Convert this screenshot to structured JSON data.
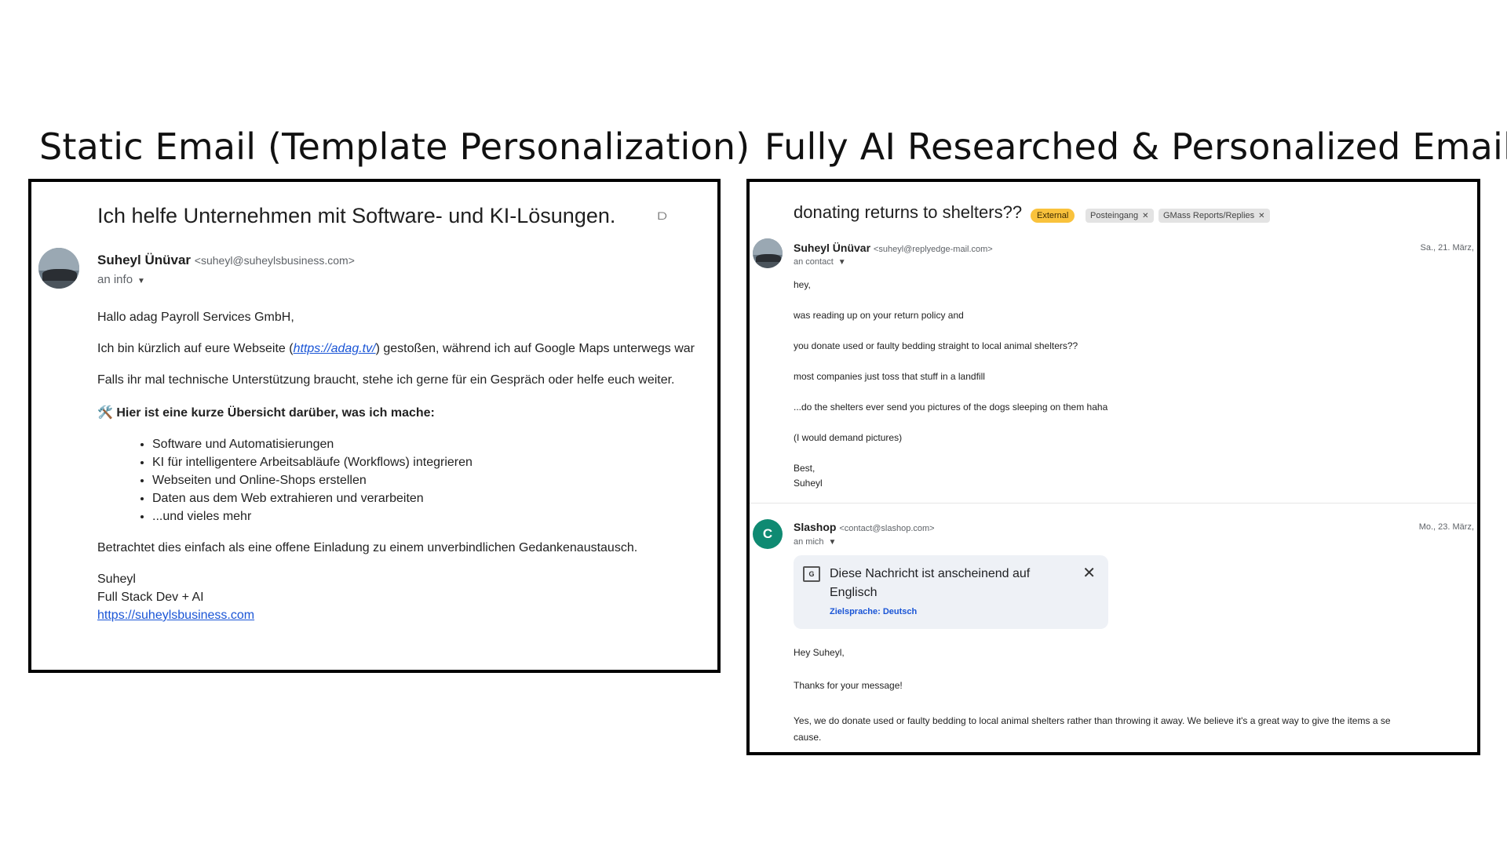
{
  "headings": {
    "left": "Static Email (Template Personalization)",
    "right": "Fully AI Researched & Personalized Email"
  },
  "left_email": {
    "subject": "Ich helfe Unternehmen mit Software- und KI-Lösungen.",
    "sender_name": "Suheyl Ünüvar",
    "sender_email": "<suheyl@suheylsbusiness.com>",
    "recipient": "an info",
    "greeting": "Hallo adag Payroll Services GmbH,",
    "intro_before_link": "Ich bin kürzlich auf eure Webseite (",
    "intro_link": "https://adag.tv/",
    "intro_after_link": ") gestoßen, während ich auf Google Maps unterwegs war",
    "offer": "Falls ihr mal technische Unterstützung braucht, stehe ich gerne für ein Gespräch oder helfe euch weiter.",
    "overview_icon": "🛠️",
    "overview_heading": "Hier ist eine kurze Übersicht darüber, was ich mache:",
    "services": [
      "Software und Automatisierungen",
      "KI für intelligentere Arbeitsabläufe (Workflows) integrieren",
      "Webseiten und Online-Shops erstellen",
      "Daten aus dem Web extrahieren und verarbeiten",
      "...und vieles mehr"
    ],
    "closing": "Betrachtet dies einfach als eine offene Einladung zu einem unverbindlichen Gedankenaustausch.",
    "signature_name": "Suheyl",
    "signature_title": "Full Stack Dev + AI",
    "signature_link": "https://suheylsbusiness.com"
  },
  "right_email": {
    "subject": "donating returns to shelters??",
    "labels": {
      "external": "External",
      "inbox": "Posteingang",
      "gmass": "GMass Reports/Replies"
    },
    "message1": {
      "sender_name": "Suheyl Ünüvar",
      "sender_email": "<suheyl@replyedge-mail.com>",
      "recipient": "an contact",
      "date": "Sa., 21. März,",
      "lines": [
        "hey,",
        "was reading up on your return policy and",
        "you donate used or faulty bedding straight to local animal shelters??",
        "most companies just toss that stuff in a landfill",
        "...do the shelters ever send you pictures of the dogs sleeping on them haha",
        "(I would demand pictures)"
      ],
      "sign_off": "Best,",
      "signature": "Suheyl"
    },
    "message2": {
      "avatar_letter": "C",
      "sender_name": "Slashop",
      "sender_email": "<contact@slashop.com>",
      "recipient": "an mich",
      "date": "Mo., 23. März,",
      "translate_notice": "Diese Nachricht ist anscheinend auf Englisch",
      "translate_target": "Zielsprache: Deutsch",
      "greeting": "Hey Suheyl,",
      "thanks": "Thanks for your message!",
      "reply_line1": "Yes, we do donate used or faulty bedding to local animal shelters rather than throwing it away. We believe it's a great way to give the items a se",
      "reply_line2": "cause."
    }
  },
  "colors": {
    "link": "#1a55d6",
    "external_badge": "#f9c23c",
    "avatar_c": "#0f8a72"
  }
}
